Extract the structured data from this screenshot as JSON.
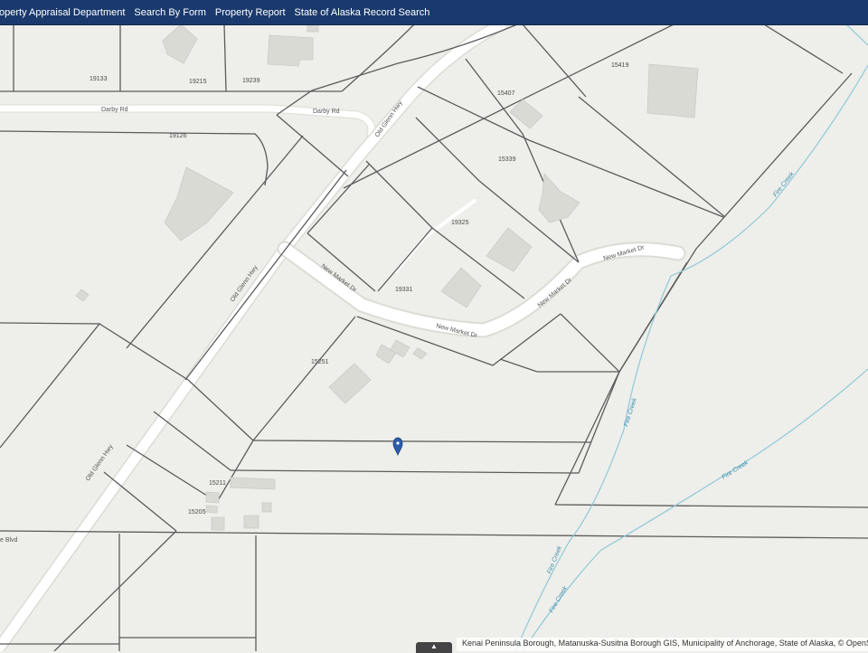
{
  "nav": {
    "items": [
      {
        "label": "Property Appraisal Department"
      },
      {
        "label": "Search By Form"
      },
      {
        "label": "Property Report"
      },
      {
        "label": "State of Alaska Record Search"
      }
    ]
  },
  "map": {
    "roads": {
      "darby_rd_a": "Darby Rd",
      "darby_rd_b": "Darby Rd",
      "old_glenn_a": "Old Glenn Hwy",
      "old_glenn_b": "Old Glenn Hwy",
      "old_glenn_c": "Old Glenn Hwy",
      "new_market_a": "New Market Dr",
      "new_market_b": "New Market Dr",
      "new_market_c": "New Market Dr",
      "new_market_d": "New Market Dr",
      "blvd_partial": "e Blvd"
    },
    "parcels": {
      "p19133": "19133",
      "p19215": "19215",
      "p19239": "19239",
      "p19126": "19126",
      "p15407": "15407",
      "p15419": "15419",
      "p15339": "15339",
      "p19325": "19325",
      "p19331": "19331",
      "p15251": "15251",
      "p15211": "15211",
      "p15205": "15205"
    },
    "creeks": {
      "c1": "Fire Creek",
      "c2": "Fire Creek",
      "c3": "Fire Creek",
      "c4": "Fire Creek",
      "c5": "Fire Creek"
    },
    "marker_icon": "map-pin-icon",
    "colors": {
      "nav_bg": "#1a3a6e",
      "parcel_line": "#5b5b5b",
      "creek": "#8fc9da",
      "marker": "#2a5caa"
    }
  },
  "attribution": "Kenai Peninsula Borough, Matanuska-Susitna Borough GIS, Municipality of Anchorage, State of Alaska, © OpenStreetMap",
  "expand_icon": "chevron-up-icon",
  "expand_glyph": "▲"
}
